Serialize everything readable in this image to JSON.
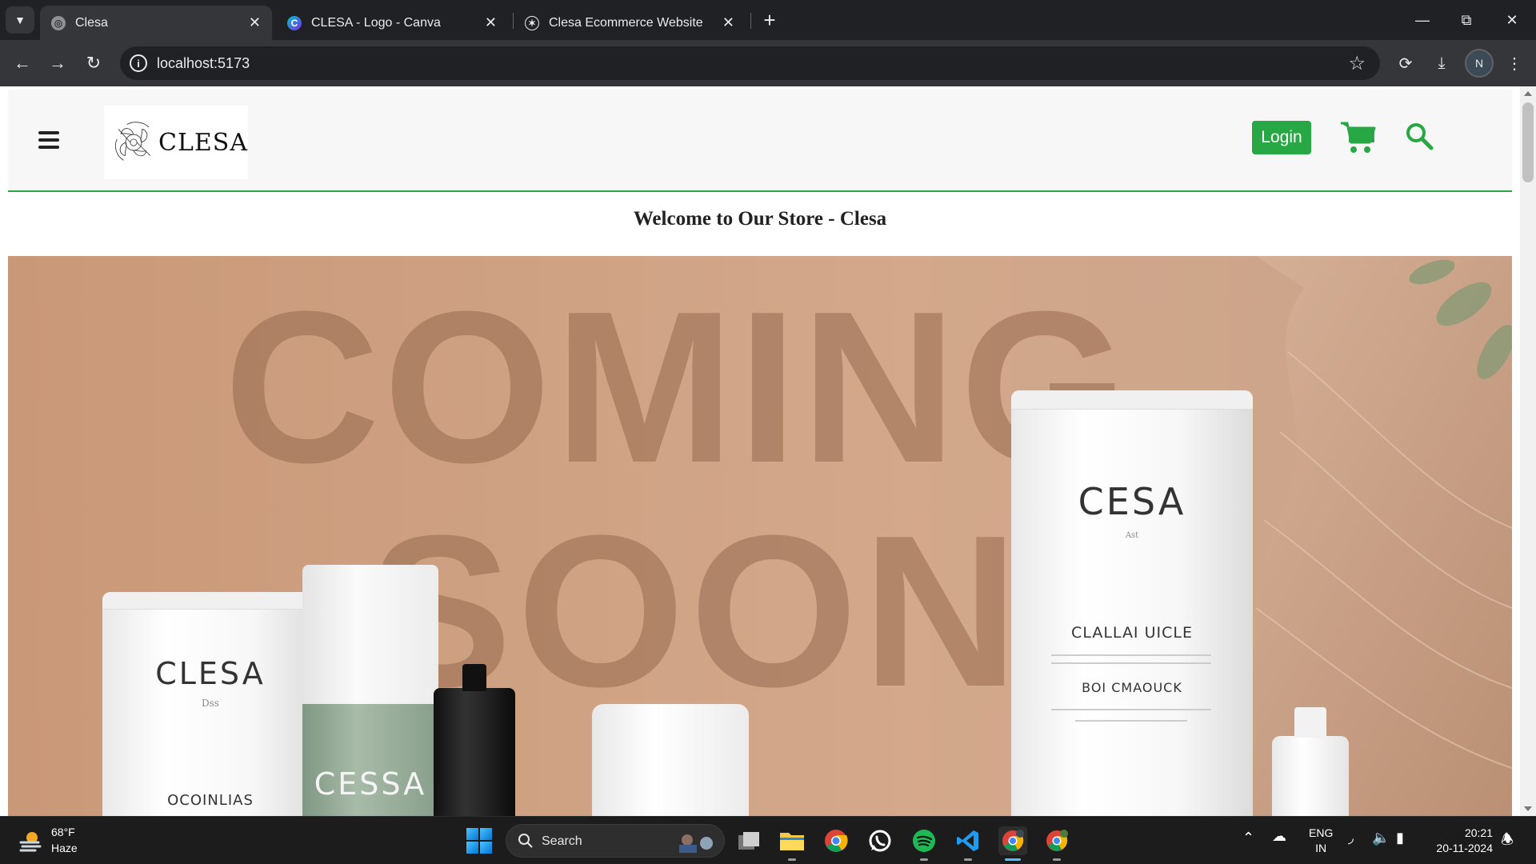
{
  "browser": {
    "tabs": [
      {
        "label": "Clesa",
        "active": true,
        "icon": "globe-icon"
      },
      {
        "label": "CLESA - Logo - Canva",
        "active": false,
        "icon": "canva-icon"
      },
      {
        "label": "Clesa Ecommerce Website",
        "active": false,
        "icon": "openai-icon"
      }
    ],
    "address": "localhost:5173",
    "profile_initial": "N"
  },
  "site": {
    "logo_text": "CLESA",
    "login_label": "Login",
    "welcome": "Welcome to Our Store - Clesa",
    "accent_color": "#28a745",
    "hero": {
      "headline_line1": "COMING",
      "headline_line2": "SOON",
      "products": [
        {
          "brand": "CLESA",
          "sub": "Dss",
          "footer": "OCOINLIAS"
        },
        {
          "brand": "CESSA"
        },
        {
          "brand": "CESA",
          "sub": "Ast",
          "line1": "CLALLAI UICLE",
          "line2": "BOI CMAOUCK"
        }
      ]
    }
  },
  "taskbar": {
    "weather_temp": "68°F",
    "weather_condition": "Haze",
    "search_label": "Search",
    "lang_line1": "ENG",
    "lang_line2": "IN",
    "time": "20:21",
    "date": "20-11-2024"
  }
}
